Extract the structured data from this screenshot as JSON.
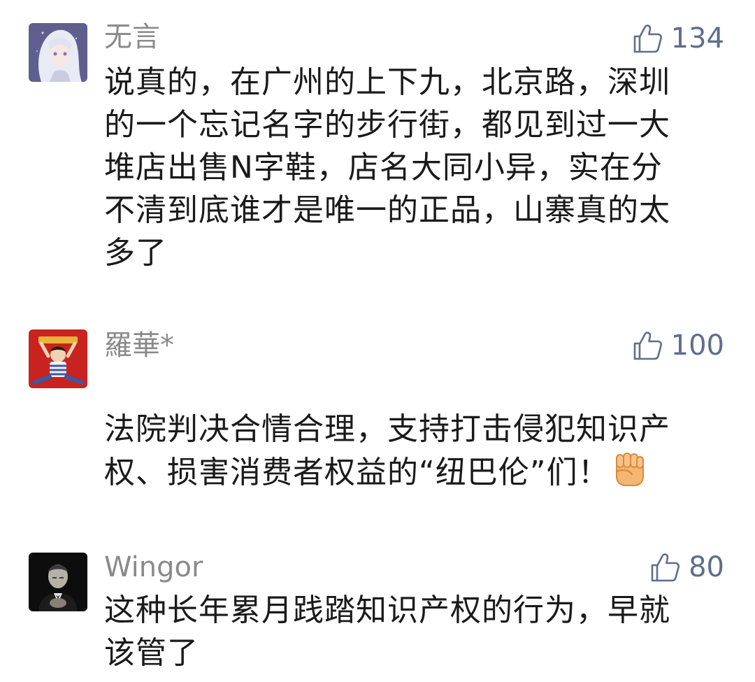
{
  "comments": [
    {
      "username": "无言",
      "likes": "134",
      "avatar": "anime-girl-avatar",
      "text": "说真的，在广州的上下九，北京路，深圳\n的一个忘记名字的步行街，都见到过一大\n堆店出售N字鞋，店名大同小异，实在分\n不清到底谁才是唯一的正品，山寨真的太\n多了"
    },
    {
      "username": "羅華*",
      "likes": "100",
      "avatar": "child-with-banner-avatar",
      "text": "法院判决合情合理，支持打击侵犯知识产\n权、损害消费者权益的“纽巴伦”们！",
      "emoji": "raised-fist-emoji"
    },
    {
      "username": "Wingor",
      "likes": "80",
      "avatar": "man-in-tuxedo-avatar",
      "text": "这种长年累月践踏知识产权的行为，早就\n该管了"
    }
  ],
  "colors": {
    "username": "#8a8a8a",
    "likes": "#5e6e8c",
    "text": "#1a1a1a",
    "background": "#ffffff"
  }
}
